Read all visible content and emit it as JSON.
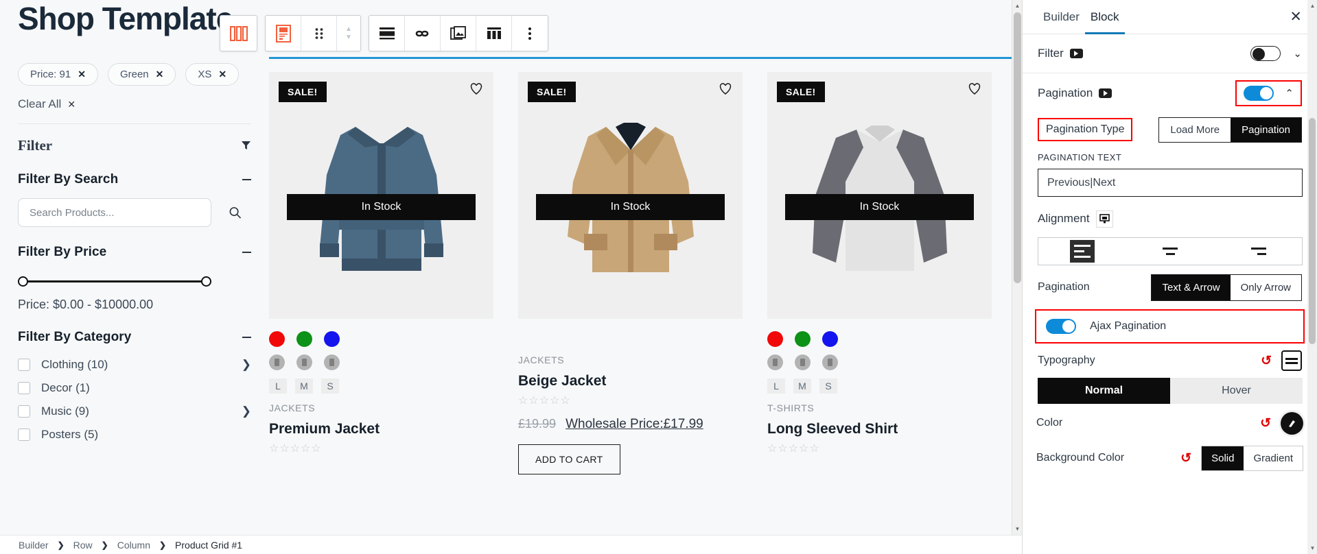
{
  "canvas": {
    "shop_title": "Shop Template",
    "active_chips": [
      {
        "label": "Price: 91",
        "remove": "✕"
      },
      {
        "label": "Green",
        "remove": "✕"
      },
      {
        "label": "XS",
        "remove": "✕"
      }
    ],
    "clear_all": "Clear All",
    "clear_all_icon": "✕",
    "filter_heading": "Filter",
    "filter_icon": "funnel-icon",
    "sections": {
      "search": {
        "title": "Filter By Search",
        "collapse_icon": "minus-icon",
        "placeholder": "Search Products...",
        "value": "",
        "button_icon": "search-icon"
      },
      "price": {
        "title": "Filter By Price",
        "collapse_icon": "minus-icon",
        "label": "Price: $0.00 - $10000.00",
        "min": "$0.00",
        "max": "$10000.00"
      },
      "category": {
        "title": "Filter By Category",
        "collapse_icon": "minus-icon",
        "items": [
          {
            "label": "Clothing (10)",
            "has_children": true,
            "checked": false
          },
          {
            "label": "Decor (1)",
            "has_children": false,
            "checked": false
          },
          {
            "label": "Music (9)",
            "has_children": true,
            "checked": false
          },
          {
            "label": "Posters (5)",
            "has_children": false,
            "checked": false
          }
        ]
      }
    },
    "toolbar": {
      "groups": [
        {
          "buttons": [
            {
              "icon": "columns-icon",
              "active": true
            }
          ]
        },
        {
          "buttons": [
            {
              "icon": "product-card-icon",
              "active": true
            },
            {
              "icon": "drag-handle-icon",
              "active": false
            },
            {
              "icon": "stepper-updown-icon",
              "active": false
            }
          ]
        },
        {
          "buttons": [
            {
              "icon": "layout-stack-icon",
              "active": false
            },
            {
              "icon": "link-infinity-icon",
              "active": false
            },
            {
              "icon": "duplicate-image-icon",
              "active": false
            },
            {
              "icon": "widget-grid-icon",
              "active": false
            },
            {
              "icon": "more-vertical-icon",
              "active": false
            }
          ]
        }
      ]
    },
    "products": [
      {
        "badge": "SALE!",
        "stock": "In Stock",
        "wishlist_icon": "heart-icon",
        "swatches": [
          "#f10808",
          "#0c9216",
          "#1414ef"
        ],
        "gray_swatches": 3,
        "sizes": [
          "L",
          "M",
          "S"
        ],
        "category": "JACKETS",
        "title": "Premium Jacket",
        "rating": "☆☆☆☆☆",
        "image": "denim-jacket"
      },
      {
        "badge": "SALE!",
        "stock": "In Stock",
        "wishlist_icon": "heart-icon",
        "swatches": [],
        "gray_swatches": 0,
        "sizes": [],
        "category": "JACKETS",
        "title": "Beige Jacket",
        "rating": "☆☆☆☆☆",
        "price_old": "£19.99",
        "price_wholesale": "Wholesale Price:£17.99",
        "add_to_cart": "ADD TO CART",
        "image": "beige-blazer"
      },
      {
        "badge": "SALE!",
        "stock": "In Stock",
        "wishlist_icon": "heart-icon",
        "swatches": [
          "#f10808",
          "#0c9216",
          "#1414ef"
        ],
        "gray_swatches": 3,
        "sizes": [
          "L",
          "M",
          "S"
        ],
        "category": "T-SHIRTS",
        "title": "Long Sleeved Shirt",
        "rating": "☆☆☆☆☆",
        "image": "raglan-shirt"
      }
    ],
    "breadcrumb": [
      "Builder",
      "Row",
      "Column",
      "Product Grid #1"
    ],
    "breadcrumb_separator": "❯"
  },
  "panel": {
    "tabs": [
      {
        "label": "Builder",
        "active": false
      },
      {
        "label": "Block",
        "active": true
      }
    ],
    "close_icon": "close-icon",
    "filter": {
      "label": "Filter",
      "video_icon": "video-tutorial-icon",
      "toggle_on": false,
      "chevron": "chevron-down-icon"
    },
    "pagination": {
      "label": "Pagination",
      "video_icon": "video-tutorial-icon",
      "toggle_on": true,
      "chevron": "chevron-up-icon",
      "highlighted": true
    },
    "pagination_type": {
      "label": "Pagination Type",
      "highlighted": true,
      "options": [
        {
          "label": "Load More",
          "selected": false
        },
        {
          "label": "Pagination",
          "selected": true
        }
      ]
    },
    "pagination_text": {
      "label": "PAGINATION TEXT",
      "value": "Previous|Next",
      "placeholder": "Previous|Next"
    },
    "alignment": {
      "label": "Alignment",
      "device_icon": "desktop-icon",
      "options": [
        {
          "icon": "align-left-icon",
          "selected": true
        },
        {
          "icon": "align-center-icon",
          "selected": false
        },
        {
          "icon": "align-right-icon",
          "selected": false
        }
      ]
    },
    "pagination_style": {
      "label": "Pagination",
      "options": [
        {
          "label": "Text & Arrow",
          "selected": true
        },
        {
          "label": "Only Arrow",
          "selected": false
        }
      ]
    },
    "ajax": {
      "label": "Ajax Pagination",
      "toggle_on": true,
      "highlighted": true
    },
    "typography": {
      "label": "Typography",
      "reset_icon": "reset-icon",
      "settings_icon": "typography-settings-icon"
    },
    "state_tabs": [
      {
        "label": "Normal",
        "selected": true
      },
      {
        "label": "Hover",
        "selected": false
      }
    ],
    "color": {
      "label": "Color",
      "reset_icon": "reset-icon",
      "picker_icon": "color-picker-icon",
      "value": "#111111"
    },
    "background_color": {
      "label": "Background Color",
      "reset_icon": "reset-icon",
      "options": [
        {
          "label": "Solid",
          "selected": true
        },
        {
          "label": "Gradient",
          "selected": false
        }
      ]
    },
    "highlight_color": "#fb0000",
    "accent_color": "#0d8bd9"
  }
}
